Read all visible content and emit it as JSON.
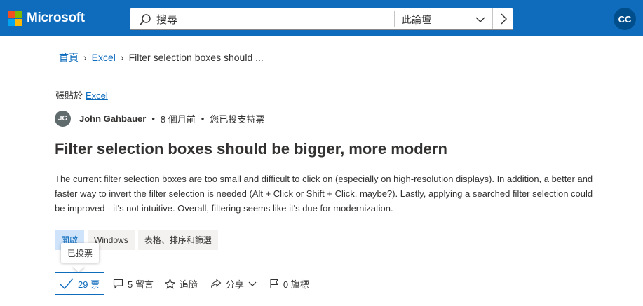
{
  "header": {
    "brand": "Microsoft",
    "search_placeholder": "搜尋",
    "scope": "此論壇",
    "user_initials": "CC",
    "brand_color": "#0f6cbd"
  },
  "breadcrumb": {
    "home": "首頁",
    "category": "Excel",
    "current": "Filter selection boxes should ..."
  },
  "post": {
    "posted_in_label": "張貼於",
    "posted_in_link": "Excel",
    "author_initials": "JG",
    "author_name": "John Gahbauer",
    "time_ago": "8 個月前",
    "vote_status": "您已投支持票",
    "title": "Filter selection boxes should be bigger, more modern",
    "body": "The current filter selection boxes are too small and difficult to click on (especially on high-resolution displays). In addition, a better and faster way to invert the filter selection is needed (Alt + Click or Shift + Click, maybe?). Lastly, applying a searched filter selection could be improved - it's not intuitive. Overall, filtering seems like it's due for modernization."
  },
  "tags": [
    "開啟",
    "Windows",
    "表格、排序和篩選"
  ],
  "tooltip": "已投票",
  "actions": {
    "votes": "29 票",
    "comments": "5 留言",
    "follow": "追隨",
    "share": "分享",
    "flags": "0 旗標"
  },
  "icons": [
    "microsoft-logo",
    "search-icon",
    "chevron-down-icon",
    "chevron-right-icon",
    "check-icon",
    "comment-icon",
    "star-icon",
    "share-icon",
    "flag-icon"
  ]
}
